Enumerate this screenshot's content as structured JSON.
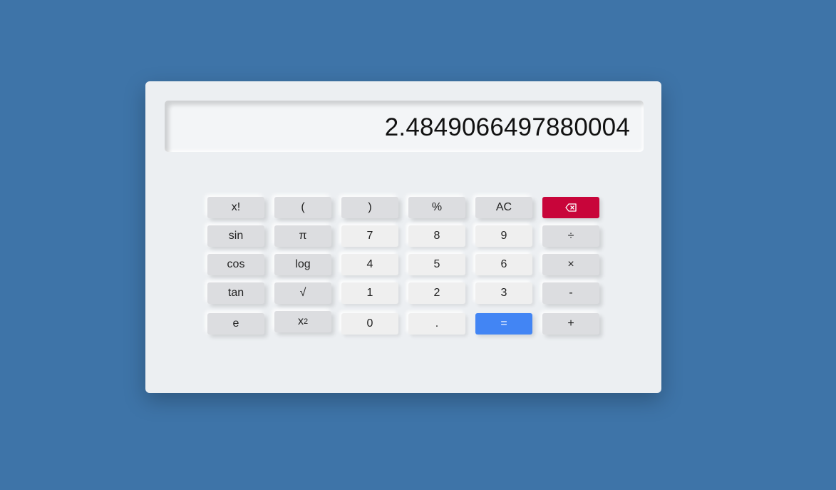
{
  "display": {
    "value": "2.4849066497880004"
  },
  "keys": {
    "row1": {
      "fact": "x!",
      "lparen": "(",
      "rparen": ")",
      "percent": "%",
      "clear": "AC"
    },
    "row2": {
      "sin": "sin",
      "pi": "π",
      "seven": "7",
      "eight": "8",
      "nine": "9",
      "divide": "÷"
    },
    "row3": {
      "cos": "cos",
      "log": "log",
      "four": "4",
      "five": "5",
      "six": "6",
      "multiply": "×"
    },
    "row4": {
      "tan": "tan",
      "sqrt": "√",
      "one": "1",
      "two": "2",
      "three": "3",
      "minus": "-"
    },
    "row5": {
      "e": "e",
      "square_base": "x",
      "square_exp": "2",
      "zero": "0",
      "dot": ".",
      "equals": "=",
      "plus": "+"
    }
  },
  "icons": {
    "backspace": "backspace-icon"
  },
  "colors": {
    "background": "#3e74a8",
    "panel": "#eceff2",
    "function_key": "#dcdde0",
    "number_key": "#efefef",
    "backspace_key": "#c8053a",
    "equals_key": "#4285f4"
  }
}
